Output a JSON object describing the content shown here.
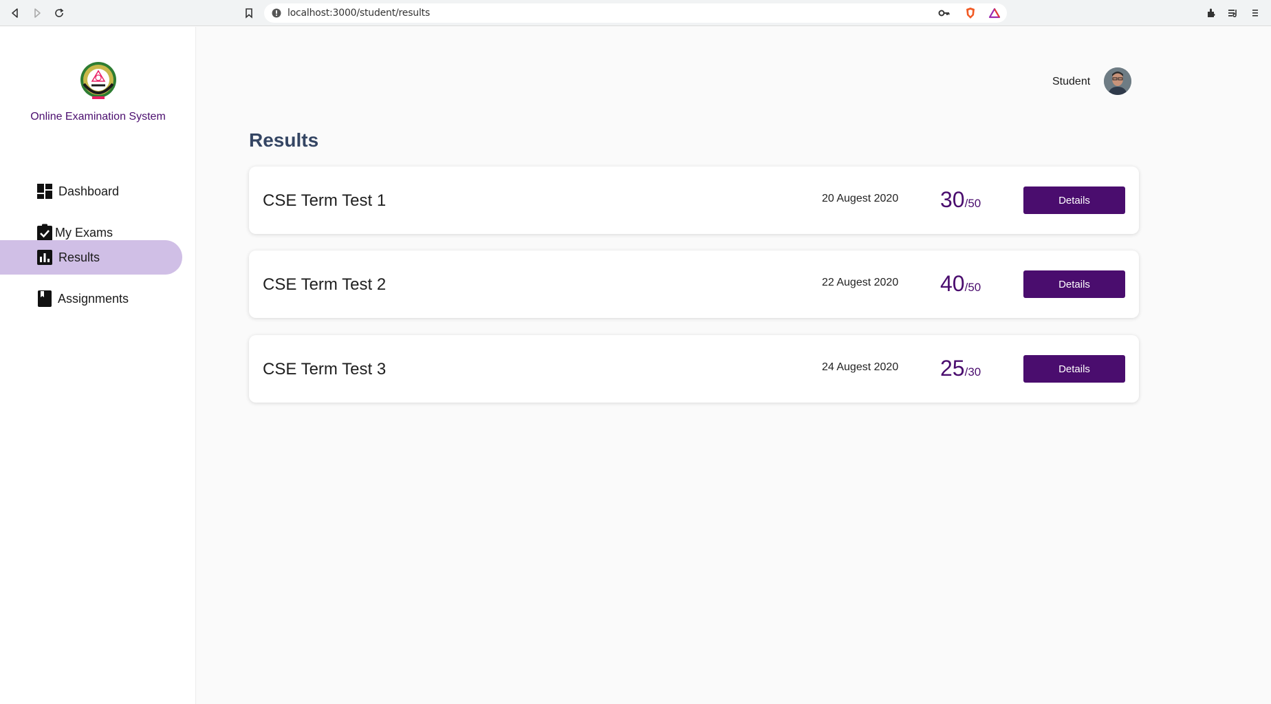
{
  "browser": {
    "url": "localhost:3000/student/results"
  },
  "sidebar": {
    "app_title": "Online Examination System",
    "items": [
      {
        "label": "Dashboard",
        "icon": "dashboard-icon",
        "active": false
      },
      {
        "label": "My Exams",
        "icon": "clipboard-check-icon",
        "active": false
      },
      {
        "label": "Results",
        "icon": "bar-chart-icon",
        "active": true
      },
      {
        "label": "Assignments",
        "icon": "book-icon",
        "active": false
      }
    ]
  },
  "header": {
    "user_role": "Student"
  },
  "main": {
    "title": "Results",
    "results": [
      {
        "name": "CSE Term Test 1",
        "date": "20 Augest 2020",
        "score": "30",
        "total": "50",
        "button": "Details"
      },
      {
        "name": "CSE Term Test 2",
        "date": "22 Augest 2020",
        "score": "40",
        "total": "50",
        "button": "Details"
      },
      {
        "name": "CSE Term Test 3",
        "date": "24 Augest 2020",
        "score": "25",
        "total": "30",
        "button": "Details"
      }
    ]
  },
  "colors": {
    "brand": "#4a0d6e",
    "active_nav_bg": "#d0bfe6",
    "title": "#344563"
  }
}
